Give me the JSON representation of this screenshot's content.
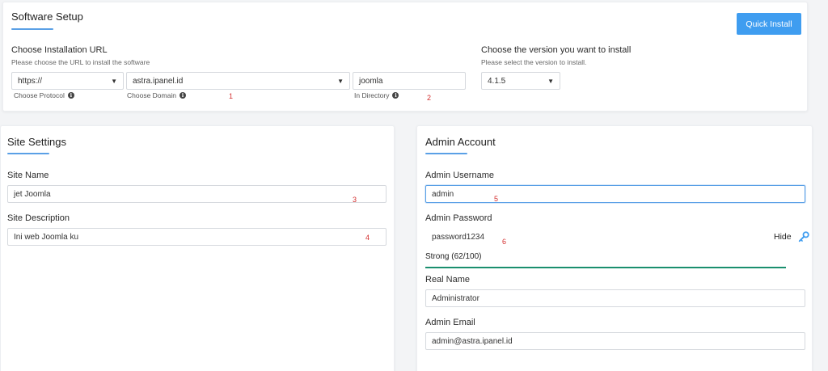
{
  "software_setup": {
    "title": "Software Setup",
    "quick_install_label": "Quick Install",
    "install_url": {
      "label": "Choose Installation URL",
      "sublabel": "Please choose the URL to install the software",
      "protocol": {
        "value": "https://",
        "hint": "Choose Protocol"
      },
      "domain": {
        "value": "astra.ipanel.id",
        "hint": "Choose Domain",
        "marker": "1"
      },
      "directory": {
        "value": "joomla",
        "hint": "In Directory",
        "marker": "2"
      }
    },
    "version": {
      "label": "Choose the version you want to install",
      "sublabel": "Please select the version to install.",
      "value": "4.1.5"
    }
  },
  "site_settings": {
    "title": "Site Settings",
    "site_name": {
      "label": "Site Name",
      "value": "jet Joomla",
      "marker": "3"
    },
    "site_description": {
      "label": "Site Description",
      "value": "Ini web Joomla ku",
      "marker": "4"
    }
  },
  "admin_account": {
    "title": "Admin Account",
    "username": {
      "label": "Admin Username",
      "value": "admin",
      "marker": "5"
    },
    "password": {
      "label": "Admin Password",
      "value": "password1234",
      "marker": "6",
      "hide_label": "Hide"
    },
    "strength": {
      "text": "Strong (62/100)",
      "score": 62,
      "color": "#1a8f6e"
    },
    "real_name": {
      "label": "Real Name",
      "value": "Administrator"
    },
    "email": {
      "label": "Admin Email",
      "value": "admin@astra.ipanel.id"
    }
  },
  "colors": {
    "accent": "#3f9df0",
    "underline": "#5aa0e6",
    "marker": "#d32f2f"
  },
  "icons": {
    "info": "info-icon",
    "key": "key-icon",
    "caret": "chevron-down-icon"
  }
}
